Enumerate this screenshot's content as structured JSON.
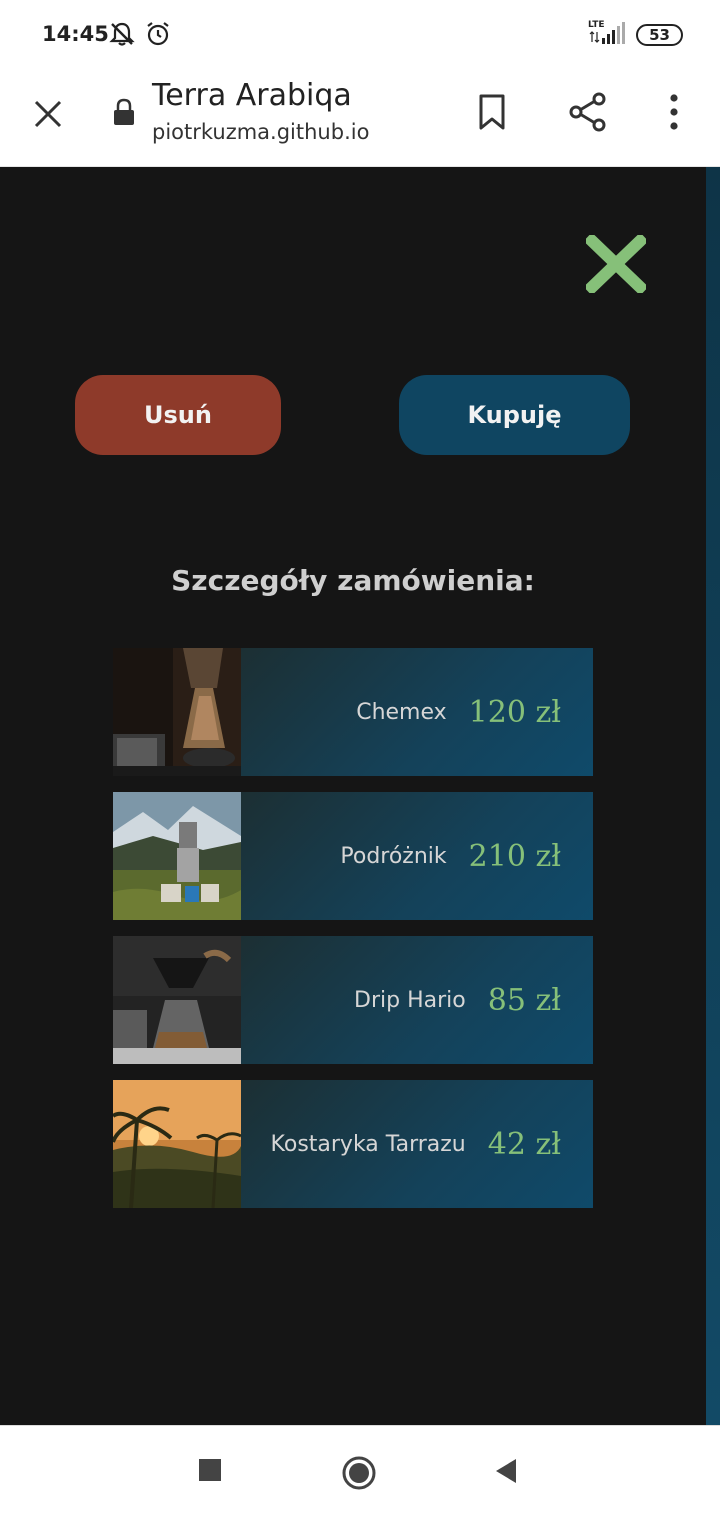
{
  "status_bar": {
    "time": "14:45",
    "network": "LTE",
    "battery": "53",
    "icons": [
      "notifications-off-icon",
      "alarm-icon",
      "signal-icon",
      "battery-icon"
    ]
  },
  "browser": {
    "page_title": "Terra Arabiqa",
    "url": "piotrkuzma.github.io",
    "icons": [
      "close-icon",
      "lock-icon",
      "bookmark-icon",
      "share-icon",
      "more-vert-icon"
    ]
  },
  "page": {
    "close_color": "#86c079",
    "remove_label": "Usuń",
    "buy_label": "Kupuję",
    "order_heading": "Szczegóły zamówienia:",
    "items": [
      {
        "name": "Chemex",
        "price": "120 zł"
      },
      {
        "name": "Podróżnik",
        "price": "210 zł"
      },
      {
        "name": "Drip Hario",
        "price": "85 zł"
      },
      {
        "name": "Kostaryka Tarrazu",
        "price": "42 zł"
      }
    ]
  },
  "colors": {
    "background": "#151515",
    "remove_button": "#8e3a2a",
    "buy_button": "#0f4561",
    "price": "#86c079"
  },
  "nav_bar": {
    "icons": [
      "recents-icon",
      "home-icon",
      "back-icon"
    ]
  }
}
